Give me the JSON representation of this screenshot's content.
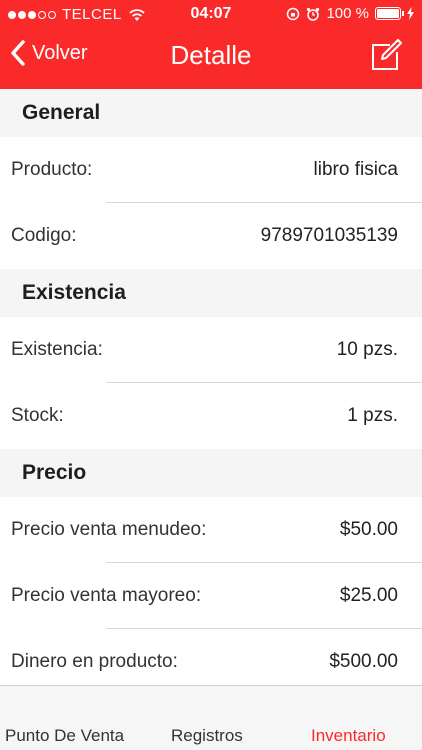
{
  "status_bar": {
    "carrier": "TELCEL",
    "time": "04:07",
    "battery": "100 %",
    "signal_icon": "signal-dots-icon",
    "wifi_icon": "wifi-icon",
    "rotation_lock_icon": "rotation-lock-icon",
    "alarm_icon": "alarm-icon",
    "battery_icon": "battery-icon",
    "charging_icon": "charging-bolt-icon"
  },
  "nav": {
    "back_label": "Volver",
    "title": "Detalle",
    "back_icon": "chevron-left-icon",
    "edit_icon": "edit-icon"
  },
  "sections": [
    {
      "header": "General",
      "rows": [
        {
          "label": "Producto:",
          "value": "libro fisica"
        },
        {
          "label": "Codigo:",
          "value": "9789701035139"
        }
      ]
    },
    {
      "header": "Existencia",
      "rows": [
        {
          "label": "Existencia:",
          "value": "10 pzs."
        },
        {
          "label": "Stock:",
          "value": "1 pzs."
        }
      ]
    },
    {
      "header": "Precio",
      "rows": [
        {
          "label": "Precio venta menudeo:",
          "value": "$50.00"
        },
        {
          "label": "Precio venta mayoreo:",
          "value": "$25.00"
        },
        {
          "label": "Dinero en producto:",
          "value": "$500.00"
        }
      ]
    }
  ],
  "tabs": [
    {
      "label": "Punto De Venta"
    },
    {
      "label": "Registros"
    },
    {
      "label": "Inventario",
      "active": true
    }
  ],
  "colors": {
    "accent": "#fb2a2a",
    "background": "#f5f5f5",
    "separator": "#d8d8d8"
  }
}
